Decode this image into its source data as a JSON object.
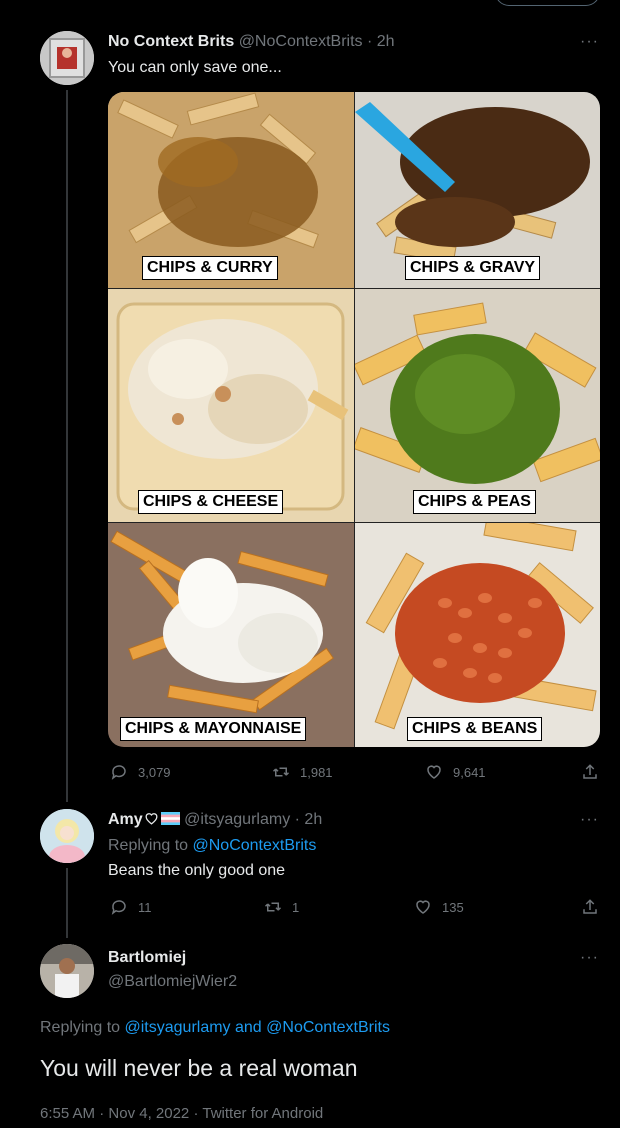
{
  "tweet1": {
    "name": "No Context Brits",
    "handle": "@NoContextBrits",
    "time": "· 2h",
    "text": "You can only save one...",
    "grid": [
      {
        "label": "CHIPS & CURRY",
        "sauce": "#8a5a1e"
      },
      {
        "label": "CHIPS & GRAVY",
        "sauce": "#4a2b14"
      },
      {
        "label": "CHIPS & CHEESE",
        "sauce": "#efe6d4"
      },
      {
        "label": "CHIPS & PEAS",
        "sauce": "#4f7a1c"
      },
      {
        "label": "CHIPS & MAYONNAISE",
        "sauce": "#f5f3ee"
      },
      {
        "label": "CHIPS & BEANS",
        "sauce": "#d25a2a"
      }
    ],
    "replies": "3,079",
    "retweets": "1,981",
    "likes": "9,641"
  },
  "tweet2": {
    "name": "Amy",
    "handle": "@itsyagurlamy",
    "time": "· 2h",
    "replying_prefix": "Replying to",
    "replying_to": "@NoContextBrits",
    "text": "Beans the only good one",
    "replies": "11",
    "retweets": "1",
    "likes": "135"
  },
  "tweet3": {
    "name": "Bartlomiej",
    "handle": "@BartlomiejWier2",
    "replying_prefix": "Replying to",
    "replying_to_1": "@itsyagurlamy",
    "replying_and": "and",
    "replying_to_2": "@NoContextBrits",
    "text": "You will never be a real woman",
    "time": "6:55 AM",
    "date": "Nov 4, 2022",
    "source": "Twitter for Android"
  },
  "colors": {
    "background": "#000000",
    "text": "#e7e9ea",
    "muted": "#71767b",
    "link": "#1d9bf0"
  },
  "icons": [
    "reply-icon",
    "retweet-icon",
    "like-icon",
    "share-icon",
    "more-icon",
    "heart-icon",
    "trans-flag-icon"
  ]
}
